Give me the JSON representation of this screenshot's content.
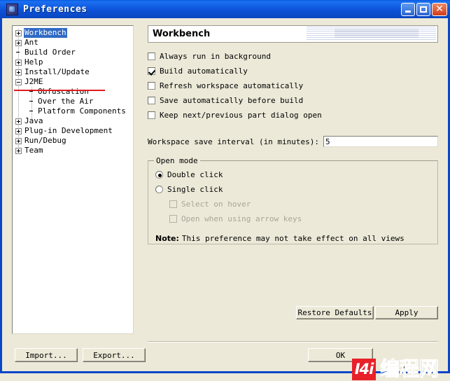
{
  "window": {
    "title": "Preferences",
    "icon": "eclipse-icon",
    "minimize_label": "",
    "maximize_label": "",
    "close_label": "✕"
  },
  "tree": {
    "items": [
      {
        "label": "Workbench",
        "indent": 0,
        "toggle": "plus",
        "selected": true
      },
      {
        "label": "Ant",
        "indent": 0,
        "toggle": "plus",
        "selected": false
      },
      {
        "label": "Build Order",
        "indent": 0,
        "toggle": "none",
        "selected": false
      },
      {
        "label": "Help",
        "indent": 0,
        "toggle": "plus",
        "selected": false
      },
      {
        "label": "Install/Update",
        "indent": 0,
        "toggle": "plus",
        "selected": false
      },
      {
        "label": "J2ME",
        "indent": 0,
        "toggle": "minus",
        "selected": false
      },
      {
        "label": "Obfuscation",
        "indent": 1,
        "toggle": "none",
        "selected": false
      },
      {
        "label": "Over the Air",
        "indent": 1,
        "toggle": "none",
        "selected": false
      },
      {
        "label": "Platform Components",
        "indent": 1,
        "toggle": "none",
        "selected": false
      },
      {
        "label": "Java",
        "indent": 0,
        "toggle": "plus",
        "selected": false
      },
      {
        "label": "Plug-in Development",
        "indent": 0,
        "toggle": "plus",
        "selected": false
      },
      {
        "label": "Run/Debug",
        "indent": 0,
        "toggle": "plus",
        "selected": false
      },
      {
        "label": "Team",
        "indent": 0,
        "toggle": "plus",
        "selected": false
      }
    ],
    "annotation_color": "#e01b1b"
  },
  "page": {
    "banner_title": "Workbench",
    "checkboxes": [
      {
        "label": "Always run in background",
        "checked": false,
        "enabled": true
      },
      {
        "label": "Build automatically",
        "checked": true,
        "enabled": true
      },
      {
        "label": "Refresh workspace automatically",
        "checked": false,
        "enabled": true
      },
      {
        "label": "Save automatically before build",
        "checked": false,
        "enabled": true
      },
      {
        "label": "Keep next/previous part dialog open",
        "checked": false,
        "enabled": true
      }
    ],
    "interval": {
      "label": "Workspace save interval (in minutes):",
      "value": "5",
      "placeholder": ""
    },
    "open_mode": {
      "title": "Open mode",
      "radios": [
        {
          "label": "Double click",
          "selected": true
        },
        {
          "label": "Single click",
          "selected": false
        }
      ],
      "sub_checkboxes": [
        {
          "label": "Select on hover",
          "checked": false,
          "enabled": false
        },
        {
          "label": "Open when using arrow keys",
          "checked": false,
          "enabled": false
        }
      ],
      "note_prefix": "Note:",
      "note_text": "This preference may not take effect on all views"
    },
    "restore_defaults_label": "Restore Defaults",
    "apply_label": "Apply"
  },
  "footer": {
    "import_label": "Import...",
    "export_label": "Export...",
    "ok_label": "OK"
  },
  "watermark": {
    "logo_text": "I4i",
    "text": "编程网",
    "logo_color": "#e8202a"
  }
}
